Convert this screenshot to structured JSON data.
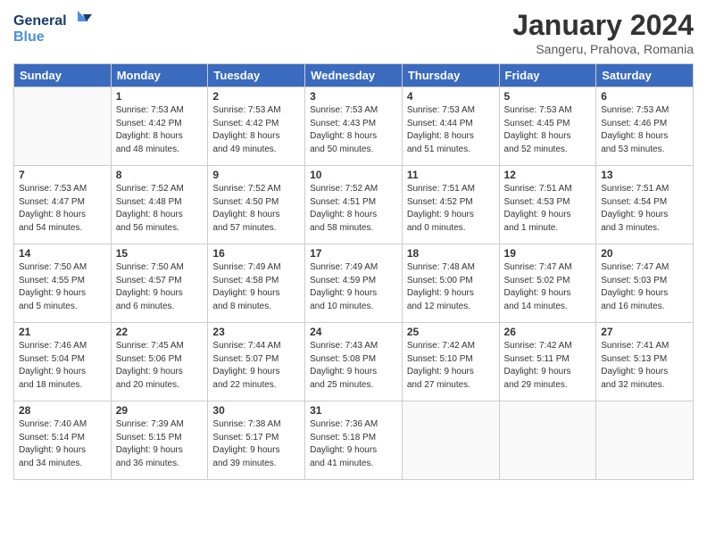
{
  "logo": {
    "line1": "General",
    "line2": "Blue"
  },
  "title": "January 2024",
  "subtitle": "Sangeru, Prahova, Romania",
  "weekdays": [
    "Sunday",
    "Monday",
    "Tuesday",
    "Wednesday",
    "Thursday",
    "Friday",
    "Saturday"
  ],
  "weeks": [
    [
      {
        "day": "",
        "info": ""
      },
      {
        "day": "1",
        "info": "Sunrise: 7:53 AM\nSunset: 4:42 PM\nDaylight: 8 hours\nand 48 minutes."
      },
      {
        "day": "2",
        "info": "Sunrise: 7:53 AM\nSunset: 4:42 PM\nDaylight: 8 hours\nand 49 minutes."
      },
      {
        "day": "3",
        "info": "Sunrise: 7:53 AM\nSunset: 4:43 PM\nDaylight: 8 hours\nand 50 minutes."
      },
      {
        "day": "4",
        "info": "Sunrise: 7:53 AM\nSunset: 4:44 PM\nDaylight: 8 hours\nand 51 minutes."
      },
      {
        "day": "5",
        "info": "Sunrise: 7:53 AM\nSunset: 4:45 PM\nDaylight: 8 hours\nand 52 minutes."
      },
      {
        "day": "6",
        "info": "Sunrise: 7:53 AM\nSunset: 4:46 PM\nDaylight: 8 hours\nand 53 minutes."
      }
    ],
    [
      {
        "day": "7",
        "info": "Sunrise: 7:53 AM\nSunset: 4:47 PM\nDaylight: 8 hours\nand 54 minutes."
      },
      {
        "day": "8",
        "info": "Sunrise: 7:52 AM\nSunset: 4:48 PM\nDaylight: 8 hours\nand 56 minutes."
      },
      {
        "day": "9",
        "info": "Sunrise: 7:52 AM\nSunset: 4:50 PM\nDaylight: 8 hours\nand 57 minutes."
      },
      {
        "day": "10",
        "info": "Sunrise: 7:52 AM\nSunset: 4:51 PM\nDaylight: 8 hours\nand 58 minutes."
      },
      {
        "day": "11",
        "info": "Sunrise: 7:51 AM\nSunset: 4:52 PM\nDaylight: 9 hours\nand 0 minutes."
      },
      {
        "day": "12",
        "info": "Sunrise: 7:51 AM\nSunset: 4:53 PM\nDaylight: 9 hours\nand 1 minute."
      },
      {
        "day": "13",
        "info": "Sunrise: 7:51 AM\nSunset: 4:54 PM\nDaylight: 9 hours\nand 3 minutes."
      }
    ],
    [
      {
        "day": "14",
        "info": "Sunrise: 7:50 AM\nSunset: 4:55 PM\nDaylight: 9 hours\nand 5 minutes."
      },
      {
        "day": "15",
        "info": "Sunrise: 7:50 AM\nSunset: 4:57 PM\nDaylight: 9 hours\nand 6 minutes."
      },
      {
        "day": "16",
        "info": "Sunrise: 7:49 AM\nSunset: 4:58 PM\nDaylight: 9 hours\nand 8 minutes."
      },
      {
        "day": "17",
        "info": "Sunrise: 7:49 AM\nSunset: 4:59 PM\nDaylight: 9 hours\nand 10 minutes."
      },
      {
        "day": "18",
        "info": "Sunrise: 7:48 AM\nSunset: 5:00 PM\nDaylight: 9 hours\nand 12 minutes."
      },
      {
        "day": "19",
        "info": "Sunrise: 7:47 AM\nSunset: 5:02 PM\nDaylight: 9 hours\nand 14 minutes."
      },
      {
        "day": "20",
        "info": "Sunrise: 7:47 AM\nSunset: 5:03 PM\nDaylight: 9 hours\nand 16 minutes."
      }
    ],
    [
      {
        "day": "21",
        "info": "Sunrise: 7:46 AM\nSunset: 5:04 PM\nDaylight: 9 hours\nand 18 minutes."
      },
      {
        "day": "22",
        "info": "Sunrise: 7:45 AM\nSunset: 5:06 PM\nDaylight: 9 hours\nand 20 minutes."
      },
      {
        "day": "23",
        "info": "Sunrise: 7:44 AM\nSunset: 5:07 PM\nDaylight: 9 hours\nand 22 minutes."
      },
      {
        "day": "24",
        "info": "Sunrise: 7:43 AM\nSunset: 5:08 PM\nDaylight: 9 hours\nand 25 minutes."
      },
      {
        "day": "25",
        "info": "Sunrise: 7:42 AM\nSunset: 5:10 PM\nDaylight: 9 hours\nand 27 minutes."
      },
      {
        "day": "26",
        "info": "Sunrise: 7:42 AM\nSunset: 5:11 PM\nDaylight: 9 hours\nand 29 minutes."
      },
      {
        "day": "27",
        "info": "Sunrise: 7:41 AM\nSunset: 5:13 PM\nDaylight: 9 hours\nand 32 minutes."
      }
    ],
    [
      {
        "day": "28",
        "info": "Sunrise: 7:40 AM\nSunset: 5:14 PM\nDaylight: 9 hours\nand 34 minutes."
      },
      {
        "day": "29",
        "info": "Sunrise: 7:39 AM\nSunset: 5:15 PM\nDaylight: 9 hours\nand 36 minutes."
      },
      {
        "day": "30",
        "info": "Sunrise: 7:38 AM\nSunset: 5:17 PM\nDaylight: 9 hours\nand 39 minutes."
      },
      {
        "day": "31",
        "info": "Sunrise: 7:36 AM\nSunset: 5:18 PM\nDaylight: 9 hours\nand 41 minutes."
      },
      {
        "day": "",
        "info": ""
      },
      {
        "day": "",
        "info": ""
      },
      {
        "day": "",
        "info": ""
      }
    ]
  ]
}
